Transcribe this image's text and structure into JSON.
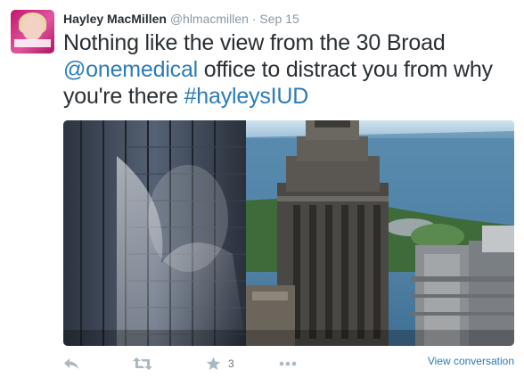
{
  "user": {
    "name": "Hayley MacMillen",
    "handle": "@hlmacmillen",
    "separator": "·",
    "time": "Sep 15"
  },
  "tweet": {
    "text_before": "Nothing like the view from the 30 Broad ",
    "mention": "@onemedical",
    "text_middle": " office to distract you from why you're there ",
    "hashtag": "#hayleysIUD"
  },
  "photo": {
    "description_icon": "city-skyline-photo"
  },
  "actions": {
    "reply_icon": "reply-icon",
    "retweet_icon": "retweet-icon",
    "favorite_icon": "star-icon",
    "favorite_count": "3",
    "more_icon": "more-icon",
    "view_conversation": "View conversation"
  },
  "colors": {
    "link": "#2b7bb9",
    "muted": "#8899a6",
    "icon": "#aab8c2",
    "text": "#292f33"
  }
}
